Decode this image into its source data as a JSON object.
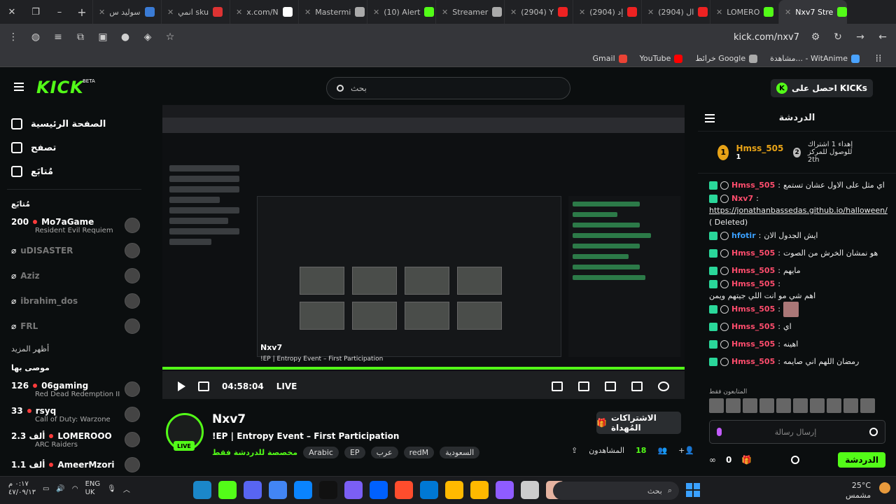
{
  "browser": {
    "tabs": [
      {
        "label": "سوليد س",
        "color": "#3a7bd5"
      },
      {
        "label": "انمي sku",
        "color": "#d33"
      },
      {
        "label": "x.com/N",
        "color": "#fff"
      },
      {
        "label": "Mastermi",
        "color": "#aaa"
      },
      {
        "label": "(10) Alert",
        "color": "#53fc18"
      },
      {
        "label": "Streamer",
        "color": "#aaa"
      },
      {
        "label": "(2904) Y",
        "color": "#e22"
      },
      {
        "label": "(2904) إد",
        "color": "#e22"
      },
      {
        "label": "(2904) ال",
        "color": "#e22"
      },
      {
        "label": "LOMERO",
        "color": "#53fc18"
      },
      {
        "label": "Nxv7 Stre",
        "color": "#53fc18"
      }
    ],
    "url": "kick.com/nxv7",
    "bookmarks": [
      {
        "label": "Gmail",
        "color": "#ea4335"
      },
      {
        "label": "YouTube",
        "color": "#ff0000"
      },
      {
        "label": "خرائط Google",
        "color": "#aaa"
      },
      {
        "label": "مشاهدة... - WitAnime",
        "color": "#4aa3ff"
      }
    ]
  },
  "header": {
    "logo": "KICK",
    "logo_badge": "BETA",
    "search_placeholder": "بحث",
    "get_kicks": "احصل على KICKs"
  },
  "sidebar": {
    "nav": [
      {
        "label": "الصفحة الرئيسية",
        "icon": "home-icon"
      },
      {
        "label": "تصفح",
        "icon": "browse-icon"
      },
      {
        "label": "مُتابَع",
        "icon": "heart-icon"
      }
    ],
    "following_title": "مُتابَع",
    "following": [
      {
        "viewers": "200",
        "name": "Mo7aGame",
        "game": "Resident Evil Requiem",
        "online": true
      },
      {
        "viewers": "",
        "name": "uDISASTER",
        "game": "",
        "online": false
      },
      {
        "viewers": "",
        "name": "Aziz",
        "game": "",
        "online": false
      },
      {
        "viewers": "",
        "name": "ibrahim_dos",
        "game": "",
        "online": false
      },
      {
        "viewers": "",
        "name": "FRL",
        "game": "",
        "online": false
      }
    ],
    "show_more": "أظهر المزيد",
    "recommended_title": "موصى بها",
    "recommended": [
      {
        "viewers": "126",
        "name": "06gaming",
        "game": "Red Dead Redemption II"
      },
      {
        "viewers": "33",
        "name": "rsyq",
        "game": "Call of Duty: Warzone"
      },
      {
        "viewers": "2.3 ألف",
        "name": "LOMEROOO",
        "game": "ARC Raiders"
      },
      {
        "viewers": "1.1 ألف",
        "name": "AmeerMzori",
        "game": ""
      }
    ]
  },
  "player": {
    "inner_channel": "Nxv7",
    "inner_title": "!EP | Entropy Event – First Participation",
    "time": "04:58:04",
    "live": "LIVE"
  },
  "channel": {
    "name": "Nxv7",
    "live_badge": "LIVE",
    "title": "!EP | Entropy Event – First Participation",
    "category": "مخصصة للدردشة فقط",
    "tags": [
      "Arabic",
      "EP",
      "عرب",
      "redM",
      "السعودية"
    ],
    "gift_button": "الاشتراكات المُهداة",
    "viewers_label": "المشاهدون",
    "viewers_count": "18"
  },
  "chat": {
    "title": "الدردشة",
    "pinned": {
      "user": "Hmss_505",
      "count": "1",
      "rank": "2",
      "goal_text": "إهداء 1 اشتراك للوصول للمركز",
      "goal_rank": "2th"
    },
    "messages": [
      {
        "user": "Hmss_505",
        "color": "#ff4d6d",
        "text": "اي مثل على الاول عشان تستمع"
      },
      {
        "user": "Nxv7",
        "color": "#ff4d6d",
        "text": "",
        "link": "https://jonathanbassedas.github.io/halloween/",
        "extra": "( Deleted)"
      },
      {
        "user": "hfotir",
        "color": "#3aa0ff",
        "text": "ايش الجدول الان"
      },
      {
        "user": "Hmss_505",
        "color": "#ff4d6d",
        "text": "هو نمشان الخرش من الصوت"
      },
      {
        "user": "Hmss_505",
        "color": "#ff4d6d",
        "text": "مايهم"
      },
      {
        "user": "Hmss_505",
        "color": "#ff4d6d",
        "text": "اهم شي مو انت اللي جيتهم ويمن"
      },
      {
        "user": "Hmss_505",
        "color": "#ff4d6d",
        "text": ""
      },
      {
        "user": "Hmss_505",
        "color": "#ff4d6d",
        "text": "اي"
      },
      {
        "user": "Hmss_505",
        "color": "#ff4d6d",
        "text": "اهينه"
      },
      {
        "user": "Hmss_505",
        "color": "#ff4d6d",
        "text": "رمضان اللهم اني صايمه"
      }
    ],
    "viewers_label": "المتابعون فقط",
    "input_placeholder": "إرسال رسالة",
    "points": "0",
    "send_label": "الدردشة"
  },
  "taskbar": {
    "time": "٠:١٧ م",
    "date": "٤٧/٠٩/١٣",
    "lang": "ENG",
    "lang2": "UK",
    "search_placeholder": "بحث",
    "temp": "25°C",
    "weather": "مشمس"
  }
}
